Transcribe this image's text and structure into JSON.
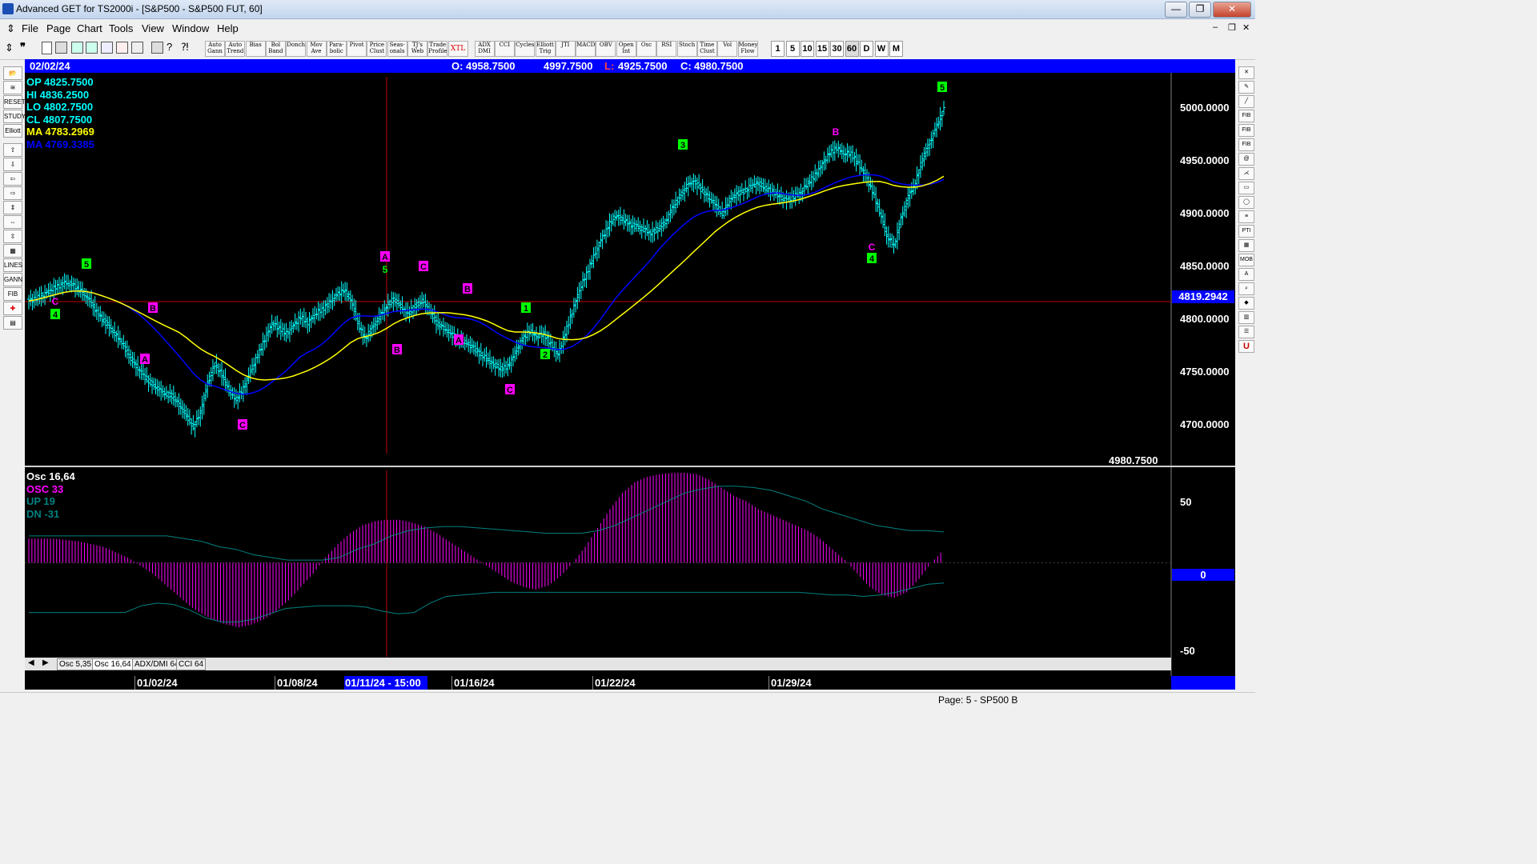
{
  "window": {
    "title": "Advanced GET for TS2000i - [S&P500 - S&P500 FUT, 60]",
    "minimize": "—",
    "maximize": "❐",
    "close": "✕",
    "inner_minimize": "–",
    "inner_restore": "❐",
    "inner_close": "✕"
  },
  "menu": [
    "File",
    "Page",
    "Chart",
    "Tools",
    "View",
    "Window",
    "Help"
  ],
  "toolbar": {
    "study_buttons": [
      "Auto Gann",
      "Auto Trend",
      "Bias",
      "Bol Band",
      "Donch",
      "Mov Ave",
      "Para-bolic",
      "Pivot",
      "Price Clust",
      "Seas-onals",
      "TJ's Web",
      "Trade Profile",
      "XTL",
      "ADX DMI",
      "CCI",
      "Cycles",
      "Elliott Trig",
      "JTI",
      "MACD",
      "OBV",
      "Open Int",
      "Osc",
      "RSI",
      "Stoch",
      "Time Clust",
      "Vol",
      "Money Flow"
    ],
    "intervals": [
      "1",
      "5",
      "10",
      "15",
      "30",
      "60",
      "D",
      "W",
      "M"
    ]
  },
  "infobar": {
    "date": "02/02/24",
    "open_label": "O:",
    "open": "4958.7500",
    "high": "4997.7500",
    "low_label": "L:",
    "low": "4925.7500",
    "close_label": "C:",
    "close": "4980.7500"
  },
  "legend": {
    "op": "OP  4825.7500",
    "hi": "HI   4836.2500",
    "lo": "LO  4802.7500",
    "cl": "CL  4807.7500",
    "ma1": "MA  4783.2969",
    "ma2": "MA  4769.3385"
  },
  "price_axis": {
    "ticks": [
      "5000.0000",
      "4950.0000",
      "4900.0000",
      "4850.0000",
      "4800.0000",
      "4750.0000",
      "4700.0000"
    ],
    "cursor_price": "4819.2942",
    "last_price": "4980.7500"
  },
  "osc_legend": {
    "title": "Osc 16,64",
    "osc": "OSC 33",
    "up": "UP   19",
    "dn": "DN   -31"
  },
  "osc_axis": {
    "ticks": [
      "50",
      "0",
      "-50"
    ]
  },
  "osc_tabs": [
    "Osc 5,35",
    "Osc 16,64",
    "ADX/DMI 64",
    "CCI 64"
  ],
  "dates": {
    "labels": [
      "01/02/24",
      "01/08/24",
      "01/16/24",
      "01/22/24",
      "01/29/24"
    ],
    "cursor": "01/11/24 - 15:00"
  },
  "status": "Page: 5 - SP500 B",
  "colors": {
    "up_bar": "#00ffff",
    "ma_fast": "#ffff00",
    "ma_slow": "#0000ff",
    "osc_hist": "#ff00ff",
    "bands": "#008080",
    "wave_green": "#00ff00",
    "wave_magenta": "#ff00ff"
  },
  "chart_data": [
    {
      "type": "candlestick",
      "title": "S&P500 FUT, 60",
      "ylim": [
        4670,
        5025
      ],
      "x_labels": [
        "01/02/24",
        "01/08/24",
        "01/16/24",
        "01/22/24",
        "01/29/24"
      ],
      "close_series": [
        4820,
        4822,
        4826,
        4830,
        4833,
        4836,
        4835,
        4830,
        4825,
        4815,
        4805,
        4798,
        4790,
        4782,
        4770,
        4760,
        4752,
        4745,
        4740,
        4735,
        4733,
        4725,
        4715,
        4705,
        4718,
        4745,
        4762,
        4752,
        4738,
        4730,
        4740,
        4755,
        4770,
        4785,
        4800,
        4795,
        4790,
        4797,
        4805,
        4800,
        4808,
        4812,
        4818,
        4825,
        4830,
        4822,
        4800,
        4785,
        4795,
        4805,
        4815,
        4822,
        4815,
        4808,
        4815,
        4820,
        4812,
        4800,
        4795,
        4790,
        4785,
        4782,
        4778,
        4772,
        4767,
        4762,
        4758,
        4760,
        4772,
        4785,
        4792,
        4788,
        4790,
        4780,
        4770,
        4790,
        4810,
        4830,
        4845,
        4860,
        4875,
        4888,
        4898,
        4895,
        4890,
        4888,
        4885,
        4882,
        4886,
        4892,
        4905,
        4915,
        4925,
        4930,
        4922,
        4915,
        4908,
        4900,
        4912,
        4918,
        4920,
        4925,
        4928,
        4923,
        4920,
        4915,
        4912,
        4915,
        4920,
        4928,
        4935,
        4945,
        4955,
        4960,
        4955,
        4955,
        4945,
        4935,
        4920,
        4902,
        4880,
        4870,
        4895,
        4915,
        4928,
        4950,
        4965,
        4980,
        4995
      ],
      "ma_fast": {
        "from": 4803,
        "to": 4930
      },
      "ma_slow": {
        "from": 4810,
        "to": 4930
      },
      "wave_labels": [
        {
          "text": "5",
          "color": "green",
          "box": true
        },
        {
          "text": "4",
          "color": "green",
          "box": true
        },
        {
          "text": "C",
          "color": "magenta"
        },
        {
          "text": "B",
          "color": "magenta",
          "box": true
        },
        {
          "text": "A",
          "color": "magenta",
          "box": true
        },
        {
          "text": "C",
          "color": "magenta",
          "box": true
        },
        {
          "text": "A",
          "color": "magenta",
          "box": true
        },
        {
          "text": "5",
          "color": "green"
        },
        {
          "text": "C",
          "color": "magenta",
          "box": true
        },
        {
          "text": "B",
          "color": "magenta",
          "box": true
        },
        {
          "text": "B",
          "color": "magenta",
          "box": true
        },
        {
          "text": "A",
          "color": "magenta",
          "box": true
        },
        {
          "text": "1",
          "color": "green",
          "box": true
        },
        {
          "text": "2",
          "color": "green",
          "box": true
        },
        {
          "text": "C",
          "color": "magenta",
          "box": true
        },
        {
          "text": "3",
          "color": "green",
          "box": true
        },
        {
          "text": "B",
          "color": "magenta"
        },
        {
          "text": "C",
          "color": "magenta"
        },
        {
          "text": "4",
          "color": "green",
          "box": true
        },
        {
          "text": "5",
          "color": "green",
          "box": true
        }
      ]
    },
    {
      "type": "bar",
      "title": "Osc 16,64",
      "ylim": [
        -50,
        50
      ],
      "osc_values": [
        18,
        18,
        18,
        17,
        16,
        14,
        12,
        8,
        4,
        -2,
        -8,
        -16,
        -24,
        -32,
        -38,
        -43,
        -46,
        -48,
        -46,
        -42,
        -36,
        -28,
        -18,
        -8,
        4,
        14,
        22,
        28,
        31,
        32,
        32,
        30,
        27,
        22,
        16,
        10,
        4,
        -2,
        -8,
        -14,
        -18,
        -20,
        -17,
        -10,
        0,
        12,
        26,
        40,
        52,
        60,
        64,
        66,
        67,
        67,
        66,
        62,
        56,
        50,
        46,
        40,
        36,
        32,
        28,
        24,
        18,
        10,
        2,
        -8,
        -18,
        -24,
        -26,
        -22,
        -12,
        0,
        10
      ],
      "up_band": [
        20,
        20,
        20,
        20,
        20,
        20,
        20,
        20,
        20,
        18,
        16,
        12,
        10,
        6,
        4,
        2,
        2,
        2,
        4,
        10,
        14,
        20,
        24,
        26,
        27,
        27,
        26,
        25,
        24,
        23,
        22,
        22,
        22,
        24,
        28,
        34,
        40,
        46,
        52,
        55,
        57,
        57,
        56,
        54,
        50,
        46,
        40,
        36,
        32,
        28,
        26,
        24,
        24,
        23
      ],
      "dn_band": [
        -37,
        -37,
        -37,
        -37,
        -37,
        -37,
        -37,
        -32,
        -30,
        -31,
        -35,
        -41,
        -44,
        -44,
        -42,
        -38,
        -34,
        -33,
        -32,
        -32,
        -32,
        -33,
        -36,
        -38,
        -37,
        -30,
        -25,
        -24,
        -23,
        -22,
        -22,
        -22,
        -22,
        -22,
        -22,
        -22,
        -22,
        -22,
        -22,
        -22,
        -22,
        -22,
        -22,
        -22,
        -22,
        -22,
        -22,
        -22,
        -22,
        -23,
        -24,
        -24,
        -25,
        -24,
        -22,
        -19,
        -16,
        -15
      ]
    }
  ]
}
